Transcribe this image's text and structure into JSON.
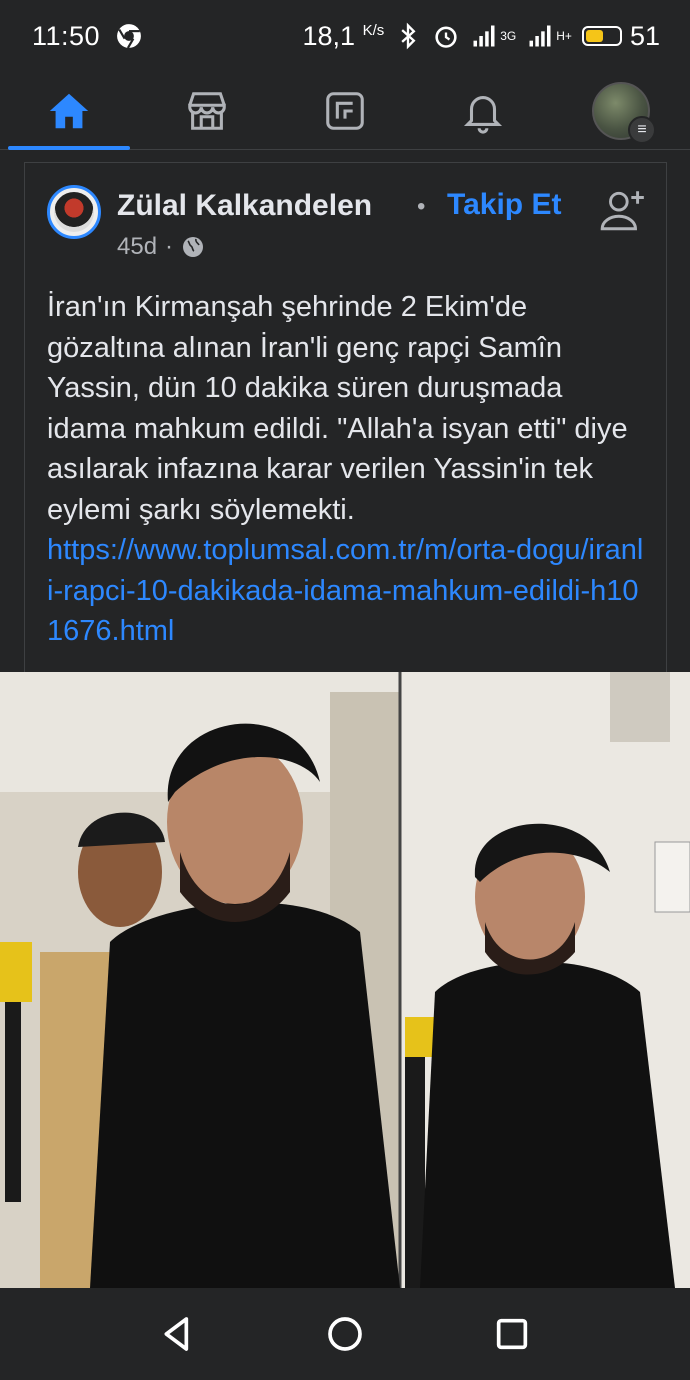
{
  "status_bar": {
    "time": "11:50",
    "speed": "18,1",
    "speed_unit": "K/s",
    "network_3g": "3G",
    "network_h": "H+",
    "battery": "51",
    "battery_level": 0.51
  },
  "nav": {
    "tabs": [
      {
        "name": "home",
        "icon": "home-icon",
        "active": true
      },
      {
        "name": "marketplace",
        "icon": "store-icon",
        "active": false
      },
      {
        "name": "feeds",
        "icon": "feed-icon",
        "active": false
      },
      {
        "name": "notifications",
        "icon": "bell-icon",
        "active": false
      },
      {
        "name": "menu",
        "icon": "profile-avatar",
        "active": false
      }
    ],
    "accent": "#2d88ff"
  },
  "post": {
    "author": "Zülal Kalkandelen",
    "separator": "•",
    "follow_label": "Takip Et",
    "time": "45d",
    "meta_sep": "·",
    "privacy_icon": "globe-icon",
    "text": "İran'ın Kirmanşah şehrinde 2 Ekim'de gözaltına alınan İran'li genç rapçi Samîn Yassin, dün 10 dakika süren duruşmada idama mahkum edildi. \"Allah'a isyan etti\" diye asılarak infazına karar verilen Yassin'in tek eylemi şarkı söylemekti.",
    "link": "https://www.toplumsal.com.tr/m/orta-dogu/iranli-rapci-10-dakikada-idama-mahkum-edildi-h101676.html"
  },
  "system_nav": {
    "back_icon": "back-triangle-icon",
    "home_icon": "home-circle-icon",
    "recents_icon": "recents-square-icon"
  }
}
